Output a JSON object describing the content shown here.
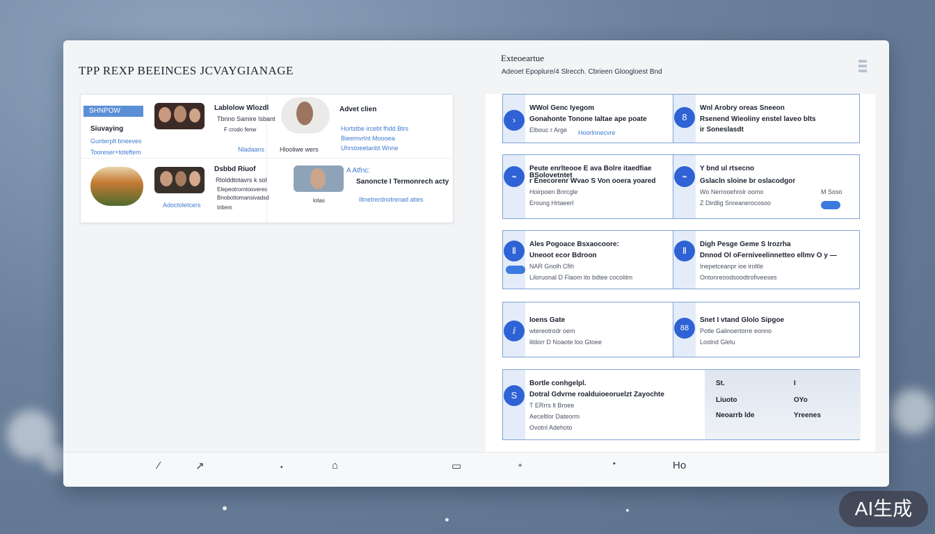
{
  "left": {
    "title": "TPP REXP BEEINCES JCVAYGIANAGE",
    "gallery": {
      "cells": [
        {
          "tag": "SHNPOW",
          "lines": [
            "Siuvaying",
            "Gunterplt bneeves",
            "Tooreser+toteftem"
          ],
          "caption_title": "Lablolow Wlozdl",
          "caption_lines": [
            "Tbnno Samire Isbant",
            "F crodo fenw"
          ],
          "caption_link": "Nladaans"
        },
        {
          "caption_title": "Advet clien",
          "caption_lines": [
            "Hortstbe ircebt fhdd Btrs",
            "Bieemvrlnt Moooea",
            "Uhrstoeetanbt Wnne"
          ],
          "footer": "Hlooliwe wers"
        },
        {
          "caption_title": "Dsbbd Riuof",
          "caption_lines": [
            "Rlolddtotavrs k sol",
            "Elepeotrorntooveres",
            "Bnobottomansivadsd",
            "tritiem"
          ],
          "caption_link": "Adoctoletcers"
        },
        {
          "caption_title": "A Atfnc:",
          "caption_lines": [
            "Sanoncte I Termonrech acty"
          ],
          "caption_link": "Iltnetrerdnotrenad aties",
          "footer": "lotas"
        }
      ]
    }
  },
  "right": {
    "title": "Exteoeartue",
    "subtitle": "Adeoet Epoplure/4 Slrecch.  Cbrieen Gloogloest  Bnd",
    "rows": [
      {
        "left": {
          "icon": "›",
          "lines": [
            "WWol Genc Iyegom",
            "Gonahonte  Tonone Ialtae ape poate",
            "Elbouc r Arge"
          ],
          "link": "Hoorlnnecvre"
        },
        "right": {
          "icon": "8",
          "lines": [
            "Wnl Arobry oreas Sneeon",
            "Rsenend  Wieoliny enstel laveo blts",
            "ir Soneslasdt"
          ]
        }
      },
      {
        "left": {
          "icon": "⌁",
          "lines": [
            "Peute enrlteooe E ava Bolre itaedfiae",
            "BSolovetntet",
            "r Enecorenr Wvao S Von ooera yoared",
            "Hoirpoen  Bnrcgle",
            "Eroung  Hrtaeerl"
          ]
        },
        "right": {
          "icon": "⌁",
          "lines": [
            "Y bnd ul rtsecno",
            "Gslacln sloine br oslacodgor",
            "Wo Nerrooehrolr oomo",
            "M Soso",
            "Z Dirdlig Snreanerocosoo"
          ]
        }
      },
      {
        "left": {
          "icon": "Ⅱ",
          "lines": [
            "Ales Pogoace Bsxaocoore:",
            "Uneoot ecor Bdroon",
            "NAR Gnolh Cfih",
            "Liloruonal D Flaom ito bdtee cocolitm"
          ]
        },
        "right": {
          "icon": "Ⅱ",
          "lines": [
            "Digh Pesge Geme S Irozrha",
            "Dnnod Ol oFerniveelinnetteo ellmv O y —",
            "Inepetceanpr ioe iroltle",
            "Ontonreoodsoodtrofiveeses"
          ]
        }
      },
      {
        "left": {
          "icon": "ⅈ",
          "lines": [
            "Ioens Gate",
            "wtereotrodr oem",
            "lildorr D Noaote loo Gtoee"
          ]
        },
        "right": {
          "icon": "88",
          "lines": [
            "Snet I vtand Glolo Sipgoe",
            "Potle Galinoertorre eonno",
            "Loolnd Glelu"
          ]
        }
      },
      {
        "left": {
          "icon": "S",
          "lines": [
            "Bortle conhgelpl.",
            "Dotral Gdvrne roalduioeoruelzt Zayochte",
            "T ERrrs lt Broee",
            "Aeceltlor Dateorm",
            "Ovotnl Adehoto"
          ]
        },
        "table": {
          "rows": [
            [
              "St.",
              "I"
            ],
            [
              "Liuoto",
              "OYo"
            ],
            [
              "Neoarrb lde",
              "Yreenes"
            ]
          ]
        }
      }
    ]
  },
  "bottom_nav": {
    "icons": [
      "back-icon",
      "edit-icon",
      "dot-icon",
      "home-icon",
      "window-icon",
      "pin-icon",
      "dot-small-icon",
      "ho-icon"
    ],
    "last_label": "Ho"
  },
  "watermark": "AI生成"
}
